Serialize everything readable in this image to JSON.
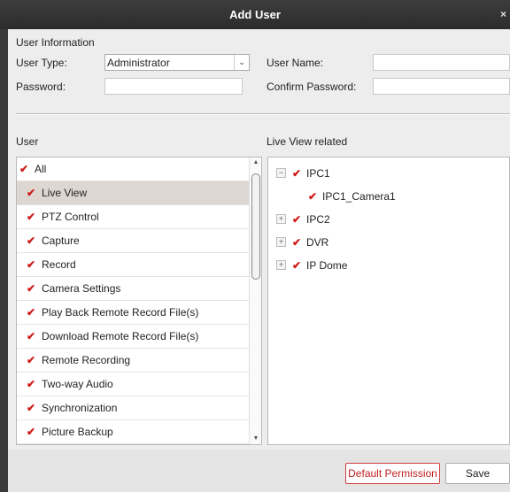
{
  "window": {
    "title": "Add User",
    "close_label": "×"
  },
  "user_info": {
    "section_label": "User Information",
    "user_type_label": "User Type:",
    "user_type_value": "Administrator",
    "user_name_label": "User Name:",
    "user_name_value": "",
    "password_label": "Password:",
    "password_value": "",
    "confirm_password_label": "Confirm Password:",
    "confirm_password_value": ""
  },
  "user_panel": {
    "heading": "User",
    "all_label": "All",
    "items": [
      {
        "label": "Live View",
        "checked": true,
        "selected": true
      },
      {
        "label": "PTZ Control",
        "checked": true
      },
      {
        "label": "Capture",
        "checked": true
      },
      {
        "label": "Record",
        "checked": true
      },
      {
        "label": "Camera Settings",
        "checked": true
      },
      {
        "label": "Play Back Remote Record File(s)",
        "checked": true
      },
      {
        "label": "Download Remote Record File(s)",
        "checked": true
      },
      {
        "label": "Remote Recording",
        "checked": true
      },
      {
        "label": "Two-way Audio",
        "checked": true
      },
      {
        "label": "Synchronization",
        "checked": true
      },
      {
        "label": "Picture Backup",
        "checked": true
      }
    ]
  },
  "live_view_panel": {
    "heading": "Live View related",
    "tree": [
      {
        "label": "IPC1",
        "expanded": true,
        "children": [
          {
            "label": "IPC1_Camera1"
          }
        ]
      },
      {
        "label": "IPC2",
        "expanded": false
      },
      {
        "label": "DVR",
        "expanded": false
      },
      {
        "label": "IP Dome",
        "expanded": false
      }
    ]
  },
  "buttons": {
    "default_permission": "Default Permission",
    "save": "Save"
  },
  "icons": {
    "check": "✔",
    "expand": "+",
    "collapse": "−",
    "dropdown": "⌄"
  },
  "colors": {
    "check": "#d01a1a",
    "default_button_border": "#d04040",
    "titlebar": "#333333"
  }
}
